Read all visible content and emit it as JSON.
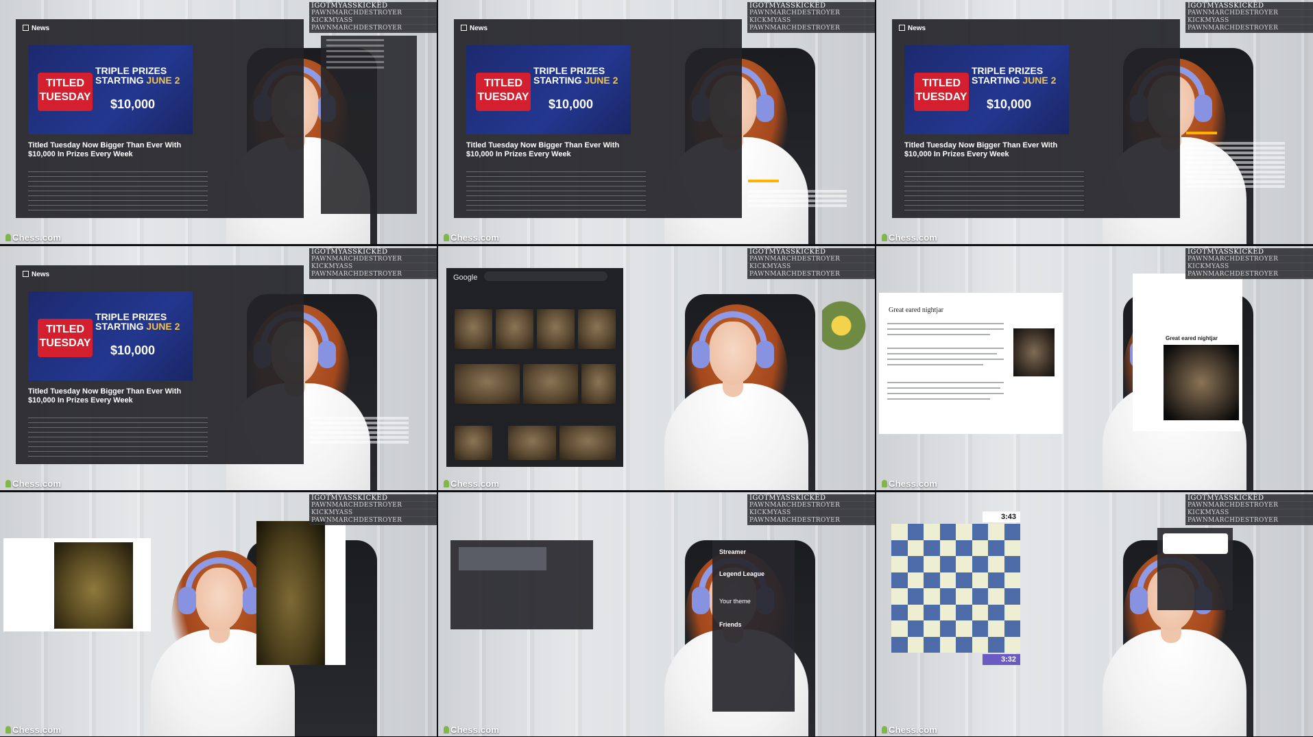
{
  "leaderboard": [
    "IGOTMYASSKICKED",
    "PAWNMARCHDESTROYER",
    "KICKMYASS",
    "PAWNMARCHDESTROYER"
  ],
  "news": {
    "header": "News",
    "banner_line1": "TRIPLE PRIZES",
    "banner_line2a": "STARTING ",
    "banner_line2b": "JUNE 2",
    "banner_tue": "TITLED TUESDAY",
    "banner_money": "$10,000",
    "title": "Titled Tuesday Now Bigger Than Ever With $10,000 In Prizes Every Week"
  },
  "watermark": "Chess.com",
  "google": {
    "logo": "Google"
  },
  "wiki": {
    "title": "Great eared nightjar",
    "caption": "Great eared nightjar"
  },
  "friends": {
    "streamer": "Streamer",
    "legend": "Legend League",
    "theme": "Your theme",
    "friends": "Friends"
  },
  "game": {
    "clock_top": "3:43",
    "clock_bottom": "3:32"
  },
  "colors": {
    "accent_purple": "#6b59c4",
    "board_dark": "#4d6ba8",
    "board_light": "#eeeed2",
    "chesscom_green": "#81b64c"
  }
}
